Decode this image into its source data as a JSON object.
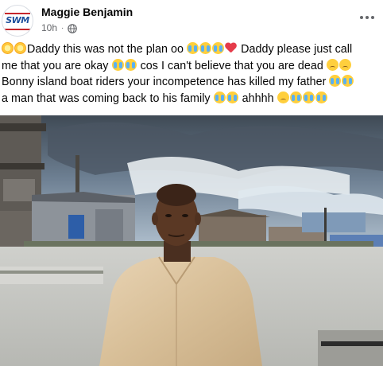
{
  "post": {
    "author": "Maggie Benjamin",
    "timestamp": "10h",
    "audience_icon": "globe-icon",
    "more_icon": "more-options-icon",
    "page_logo": "SWM",
    "text_lines": [
      [
        {
          "t": "emoji",
          "kind": "em-sun",
          "name": "sun-emoji"
        },
        {
          "t": "emoji",
          "kind": "em-sun",
          "name": "sun-emoji"
        },
        {
          "t": "text",
          "v": "Daddy this was not the plan oo "
        },
        {
          "t": "emoji",
          "kind": "em-cry",
          "name": "crying-face-emoji"
        },
        {
          "t": "emoji",
          "kind": "em-cry",
          "name": "crying-face-emoji"
        },
        {
          "t": "emoji",
          "kind": "em-cry",
          "name": "crying-face-emoji"
        },
        {
          "t": "emoji",
          "kind": "em-heart",
          "name": "broken-heart-emoji"
        },
        {
          "t": "text",
          "v": " Daddy please just call"
        }
      ],
      [
        {
          "t": "text",
          "v": "me that you are okay "
        },
        {
          "t": "emoji",
          "kind": "em-cry",
          "name": "crying-face-emoji"
        },
        {
          "t": "emoji",
          "kind": "em-cry",
          "name": "crying-face-emoji"
        },
        {
          "t": "text",
          "v": " cos I can't believe that you are dead "
        },
        {
          "t": "emoji",
          "kind": "em-sad",
          "name": "pensive-face-emoji"
        },
        {
          "t": "emoji",
          "kind": "em-sad",
          "name": "pensive-face-emoji"
        }
      ],
      [
        {
          "t": "text",
          "v": "Bonny island boat riders your incompetence has killed my father "
        },
        {
          "t": "emoji",
          "kind": "em-cry",
          "name": "crying-face-emoji"
        },
        {
          "t": "emoji",
          "kind": "em-cry",
          "name": "crying-face-emoji"
        }
      ],
      [
        {
          "t": "text",
          "v": "a man that was coming back to his family "
        },
        {
          "t": "emoji",
          "kind": "em-cry",
          "name": "crying-face-emoji"
        },
        {
          "t": "emoji",
          "kind": "em-cry",
          "name": "crying-face-emoji"
        },
        {
          "t": "text",
          "v": " ahhhh "
        },
        {
          "t": "emoji",
          "kind": "em-sad",
          "name": "pensive-face-emoji"
        },
        {
          "t": "emoji",
          "kind": "em-cry",
          "name": "crying-face-emoji"
        },
        {
          "t": "emoji",
          "kind": "em-cry",
          "name": "crying-face-emoji"
        },
        {
          "t": "emoji",
          "kind": "em-cry",
          "name": "crying-face-emoji"
        }
      ]
    ]
  },
  "photo": {
    "subject": "man-in-beige-kaftan-photo"
  },
  "colors": {
    "name_text": "#050505",
    "secondary_text": "#65676b",
    "logo_blue": "#1d4f9c",
    "logo_red": "#c7262b"
  }
}
